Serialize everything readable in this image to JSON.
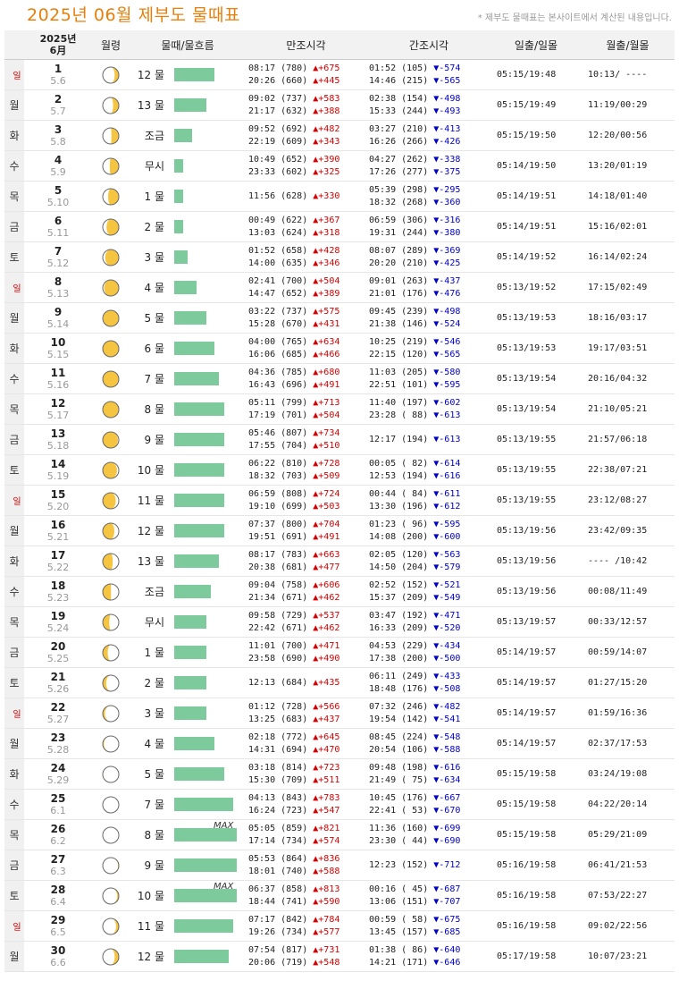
{
  "header": {
    "title": "2025년 06월 제부도 물때표",
    "note": "* 제부도 물때표는 본사이트에서 계산된 내용입니다."
  },
  "columns": {
    "date_year": "2025년",
    "date_month": "6月",
    "moon": "월령",
    "tide": "물때/물흐름",
    "high": "만조시각",
    "low": "간조시각",
    "sun": "일출/일몰",
    "moonrise": "월출/월몰"
  },
  "colors": {
    "sunday": "#d60000",
    "rise": "#d60000",
    "fall": "#0000cc",
    "bar": "#7dcb9d",
    "title": "#e87f0a"
  },
  "rows": [
    {
      "dow": "일",
      "day": "1",
      "lunar": "5.6",
      "tide": "12 물",
      "flow": 0.5,
      "max": "",
      "high": [
        {
          "t": "08:17 (780)",
          "c": "▲+675"
        },
        {
          "t": "20:26 (660)",
          "c": "▲+445"
        }
      ],
      "low": [
        {
          "t": "01:52 (105)",
          "c": "▼-574"
        },
        {
          "t": "14:46 (215)",
          "c": "▼-565"
        }
      ],
      "sun": "05:15/19:48",
      "moon": "10:13/ ----"
    },
    {
      "dow": "월",
      "day": "2",
      "lunar": "5.7",
      "tide": "13 물",
      "flow": 0.4,
      "max": "",
      "high": [
        {
          "t": "09:02 (737)",
          "c": "▲+583"
        },
        {
          "t": "21:17 (632)",
          "c": "▲+388"
        }
      ],
      "low": [
        {
          "t": "02:38 (154)",
          "c": "▼-498"
        },
        {
          "t": "15:33 (244)",
          "c": "▼-493"
        }
      ],
      "sun": "05:15/19:49",
      "moon": "11:19/00:29"
    },
    {
      "dow": "화",
      "day": "3",
      "lunar": "5.8",
      "tide": "조금",
      "flow": 0.22,
      "max": "",
      "high": [
        {
          "t": "09:52 (692)",
          "c": "▲+482"
        },
        {
          "t": "22:19 (609)",
          "c": "▲+343"
        }
      ],
      "low": [
        {
          "t": "03:27 (210)",
          "c": "▼-413"
        },
        {
          "t": "16:26 (266)",
          "c": "▼-426"
        }
      ],
      "sun": "05:15/19:50",
      "moon": "12:20/00:56"
    },
    {
      "dow": "수",
      "day": "4",
      "lunar": "5.9",
      "tide": "무시",
      "flow": 0.11,
      "max": "",
      "high": [
        {
          "t": "10:49 (652)",
          "c": "▲+390"
        },
        {
          "t": "23:33 (602)",
          "c": "▲+325"
        }
      ],
      "low": [
        {
          "t": "04:27 (262)",
          "c": "▼-338"
        },
        {
          "t": "17:26 (277)",
          "c": "▼-375"
        }
      ],
      "sun": "05:14/19:50",
      "moon": "13:20/01:19"
    },
    {
      "dow": "목",
      "day": "5",
      "lunar": "5.10",
      "tide": "1 물",
      "flow": 0.11,
      "max": "",
      "high": [
        {
          "t": "11:56 (628)",
          "c": "▲+330"
        }
      ],
      "low": [
        {
          "t": "05:39 (298)",
          "c": "▼-295"
        },
        {
          "t": "18:32 (268)",
          "c": "▼-360"
        }
      ],
      "sun": "05:14/19:51",
      "moon": "14:18/01:40"
    },
    {
      "dow": "금",
      "day": "6",
      "lunar": "5.11",
      "tide": "2 물",
      "flow": 0.11,
      "max": "",
      "high": [
        {
          "t": "00:49 (622)",
          "c": "▲+367"
        },
        {
          "t": "13:03 (624)",
          "c": "▲+318"
        }
      ],
      "low": [
        {
          "t": "06:59 (306)",
          "c": "▼-316"
        },
        {
          "t": "19:31 (244)",
          "c": "▼-380"
        }
      ],
      "sun": "05:14/19:51",
      "moon": "15:16/02:01"
    },
    {
      "dow": "토",
      "day": "7",
      "lunar": "5.12",
      "tide": "3 물",
      "flow": 0.17,
      "max": "",
      "high": [
        {
          "t": "01:52 (658)",
          "c": "▲+428"
        },
        {
          "t": "14:00 (635)",
          "c": "▲+346"
        }
      ],
      "low": [
        {
          "t": "08:07 (289)",
          "c": "▼-369"
        },
        {
          "t": "20:20 (210)",
          "c": "▼-425"
        }
      ],
      "sun": "05:14/19:52",
      "moon": "16:14/02:24"
    },
    {
      "dow": "일",
      "day": "8",
      "lunar": "5.13",
      "tide": "4 물",
      "flow": 0.28,
      "max": "",
      "high": [
        {
          "t": "02:41 (700)",
          "c": "▲+504"
        },
        {
          "t": "14:47 (652)",
          "c": "▲+389"
        }
      ],
      "low": [
        {
          "t": "09:01 (263)",
          "c": "▼-437"
        },
        {
          "t": "21:01 (176)",
          "c": "▼-476"
        }
      ],
      "sun": "05:13/19:52",
      "moon": "17:15/02:49"
    },
    {
      "dow": "월",
      "day": "9",
      "lunar": "5.14",
      "tide": "5 물",
      "flow": 0.4,
      "max": "",
      "high": [
        {
          "t": "03:22 (737)",
          "c": "▲+575"
        },
        {
          "t": "15:28 (670)",
          "c": "▲+431"
        }
      ],
      "low": [
        {
          "t": "09:45 (239)",
          "c": "▼-498"
        },
        {
          "t": "21:38 (146)",
          "c": "▼-524"
        }
      ],
      "sun": "05:13/19:53",
      "moon": "18:16/03:17"
    },
    {
      "dow": "화",
      "day": "10",
      "lunar": "5.15",
      "tide": "6 물",
      "flow": 0.5,
      "max": "",
      "high": [
        {
          "t": "04:00 (765)",
          "c": "▲+634"
        },
        {
          "t": "16:06 (685)",
          "c": "▲+466"
        }
      ],
      "low": [
        {
          "t": "10:25 (219)",
          "c": "▼-546"
        },
        {
          "t": "22:15 (120)",
          "c": "▼-565"
        }
      ],
      "sun": "05:13/19:53",
      "moon": "19:17/03:51"
    },
    {
      "dow": "수",
      "day": "11",
      "lunar": "5.16",
      "tide": "7 물",
      "flow": 0.56,
      "max": "",
      "high": [
        {
          "t": "04:36 (785)",
          "c": "▲+680"
        },
        {
          "t": "16:43 (696)",
          "c": "▲+491"
        }
      ],
      "low": [
        {
          "t": "11:03 (205)",
          "c": "▼-580"
        },
        {
          "t": "22:51 (101)",
          "c": "▼-595"
        }
      ],
      "sun": "05:13/19:54",
      "moon": "20:16/04:32"
    },
    {
      "dow": "목",
      "day": "12",
      "lunar": "5.17",
      "tide": "8 물",
      "flow": 0.62,
      "max": "",
      "high": [
        {
          "t": "05:11 (799)",
          "c": "▲+713"
        },
        {
          "t": "17:19 (701)",
          "c": "▲+504"
        }
      ],
      "low": [
        {
          "t": "11:40 (197)",
          "c": "▼-602"
        },
        {
          "t": "23:28 ( 88)",
          "c": "▼-613"
        }
      ],
      "sun": "05:13/19:54",
      "moon": "21:10/05:21"
    },
    {
      "dow": "금",
      "day": "13",
      "lunar": "5.18",
      "tide": "9 물",
      "flow": 0.62,
      "max": "",
      "high": [
        {
          "t": "05:46 (807)",
          "c": "▲+734"
        },
        {
          "t": "17:55 (704)",
          "c": "▲+510"
        }
      ],
      "low": [
        {
          "t": "12:17 (194)",
          "c": "▼-613"
        }
      ],
      "sun": "05:13/19:55",
      "moon": "21:57/06:18"
    },
    {
      "dow": "토",
      "day": "14",
      "lunar": "5.19",
      "tide": "10 물",
      "flow": 0.62,
      "max": "",
      "high": [
        {
          "t": "06:22 (810)",
          "c": "▲+728"
        },
        {
          "t": "18:32 (703)",
          "c": "▲+509"
        }
      ],
      "low": [
        {
          "t": "00:05 ( 82)",
          "c": "▼-614"
        },
        {
          "t": "12:53 (194)",
          "c": "▼-616"
        }
      ],
      "sun": "05:13/19:55",
      "moon": "22:38/07:21"
    },
    {
      "dow": "일",
      "day": "15",
      "lunar": "5.20",
      "tide": "11 물",
      "flow": 0.62,
      "max": "",
      "high": [
        {
          "t": "06:59 (808)",
          "c": "▲+724"
        },
        {
          "t": "19:10 (699)",
          "c": "▲+503"
        }
      ],
      "low": [
        {
          "t": "00:44 ( 84)",
          "c": "▼-611"
        },
        {
          "t": "13:30 (196)",
          "c": "▼-612"
        }
      ],
      "sun": "05:13/19:55",
      "moon": "23:12/08:27"
    },
    {
      "dow": "월",
      "day": "16",
      "lunar": "5.21",
      "tide": "12 물",
      "flow": 0.62,
      "max": "",
      "high": [
        {
          "t": "07:37 (800)",
          "c": "▲+704"
        },
        {
          "t": "19:51 (691)",
          "c": "▲+491"
        }
      ],
      "low": [
        {
          "t": "01:23 ( 96)",
          "c": "▼-595"
        },
        {
          "t": "14:08 (200)",
          "c": "▼-600"
        }
      ],
      "sun": "05:13/19:56",
      "moon": "23:42/09:35"
    },
    {
      "dow": "화",
      "day": "17",
      "lunar": "5.22",
      "tide": "13 물",
      "flow": 0.56,
      "max": "",
      "high": [
        {
          "t": "08:17 (783)",
          "c": "▲+663"
        },
        {
          "t": "20:38 (681)",
          "c": "▲+477"
        }
      ],
      "low": [
        {
          "t": "02:05 (120)",
          "c": "▼-563"
        },
        {
          "t": "14:50 (204)",
          "c": "▼-579"
        }
      ],
      "sun": "05:13/19:56",
      "moon": "---- /10:42"
    },
    {
      "dow": "수",
      "day": "18",
      "lunar": "5.23",
      "tide": "조금",
      "flow": 0.45,
      "max": "",
      "high": [
        {
          "t": "09:04 (758)",
          "c": "▲+606"
        },
        {
          "t": "21:34 (671)",
          "c": "▲+462"
        }
      ],
      "low": [
        {
          "t": "02:52 (152)",
          "c": "▼-521"
        },
        {
          "t": "15:37 (209)",
          "c": "▼-549"
        }
      ],
      "sun": "05:13/19:56",
      "moon": "00:08/11:49"
    },
    {
      "dow": "목",
      "day": "19",
      "lunar": "5.24",
      "tide": "무시",
      "flow": 0.4,
      "max": "",
      "high": [
        {
          "t": "09:58 (729)",
          "c": "▲+537"
        },
        {
          "t": "22:42 (671)",
          "c": "▲+462"
        }
      ],
      "low": [
        {
          "t": "03:47 (192)",
          "c": "▼-471"
        },
        {
          "t": "16:33 (209)",
          "c": "▼-520"
        }
      ],
      "sun": "05:13/19:57",
      "moon": "00:33/12:57"
    },
    {
      "dow": "금",
      "day": "20",
      "lunar": "5.25",
      "tide": "1 물",
      "flow": 0.4,
      "max": "",
      "high": [
        {
          "t": "11:01 (700)",
          "c": "▲+471"
        },
        {
          "t": "23:58 (690)",
          "c": "▲+490"
        }
      ],
      "low": [
        {
          "t": "04:53 (229)",
          "c": "▼-434"
        },
        {
          "t": "17:38 (200)",
          "c": "▼-500"
        }
      ],
      "sun": "05:14/19:57",
      "moon": "00:59/14:07"
    },
    {
      "dow": "토",
      "day": "21",
      "lunar": "5.26",
      "tide": "2 물",
      "flow": 0.4,
      "max": "",
      "high": [
        {
          "t": "12:13 (684)",
          "c": "▲+435"
        }
      ],
      "low": [
        {
          "t": "06:11 (249)",
          "c": "▼-433"
        },
        {
          "t": "18:48 (176)",
          "c": "▼-508"
        }
      ],
      "sun": "05:14/19:57",
      "moon": "01:27/15:20"
    },
    {
      "dow": "일",
      "day": "22",
      "lunar": "5.27",
      "tide": "3 물",
      "flow": 0.4,
      "max": "",
      "high": [
        {
          "t": "01:12 (728)",
          "c": "▲+566"
        },
        {
          "t": "13:25 (683)",
          "c": "▲+437"
        }
      ],
      "low": [
        {
          "t": "07:32 (246)",
          "c": "▼-482"
        },
        {
          "t": "19:54 (142)",
          "c": "▼-541"
        }
      ],
      "sun": "05:14/19:57",
      "moon": "01:59/16:36"
    },
    {
      "dow": "월",
      "day": "23",
      "lunar": "5.28",
      "tide": "4 물",
      "flow": 0.5,
      "max": "",
      "high": [
        {
          "t": "02:18 (772)",
          "c": "▲+645"
        },
        {
          "t": "14:31 (694)",
          "c": "▲+470"
        }
      ],
      "low": [
        {
          "t": "08:45 (224)",
          "c": "▼-548"
        },
        {
          "t": "20:54 (106)",
          "c": "▼-588"
        }
      ],
      "sun": "05:14/19:57",
      "moon": "02:37/17:53"
    },
    {
      "dow": "화",
      "day": "24",
      "lunar": "5.29",
      "tide": "5 물",
      "flow": 0.62,
      "max": "",
      "high": [
        {
          "t": "03:18 (814)",
          "c": "▲+723"
        },
        {
          "t": "15:30 (709)",
          "c": "▲+511"
        }
      ],
      "low": [
        {
          "t": "09:48 (198)",
          "c": "▼-616"
        },
        {
          "t": "21:49 ( 75)",
          "c": "▼-634"
        }
      ],
      "sun": "05:15/19:58",
      "moon": "03:24/19:08"
    },
    {
      "dow": "수",
      "day": "25",
      "lunar": "6.1",
      "tide": "7 물",
      "flow": 0.73,
      "max": "",
      "high": [
        {
          "t": "04:13 (843)",
          "c": "▲+783"
        },
        {
          "t": "16:24 (723)",
          "c": "▲+547"
        }
      ],
      "low": [
        {
          "t": "10:45 (176)",
          "c": "▼-667"
        },
        {
          "t": "22:41 ( 53)",
          "c": "▼-670"
        }
      ],
      "sun": "05:15/19:58",
      "moon": "04:22/20:14"
    },
    {
      "dow": "목",
      "day": "26",
      "lunar": "6.2",
      "tide": "8 물",
      "flow": 0.78,
      "max": "MAX",
      "high": [
        {
          "t": "05:05 (859)",
          "c": "▲+821"
        },
        {
          "t": "17:14 (734)",
          "c": "▲+574"
        }
      ],
      "low": [
        {
          "t": "11:36 (160)",
          "c": "▼-699"
        },
        {
          "t": "23:30 ( 44)",
          "c": "▼-690"
        }
      ],
      "sun": "05:15/19:58",
      "moon": "05:29/21:09"
    },
    {
      "dow": "금",
      "day": "27",
      "lunar": "6.3",
      "tide": "9 물",
      "flow": 0.78,
      "max": "",
      "high": [
        {
          "t": "05:53 (864)",
          "c": "▲+836"
        },
        {
          "t": "18:01 (740)",
          "c": "▲+588"
        }
      ],
      "low": [
        {
          "t": "12:23 (152)",
          "c": "▼-712"
        }
      ],
      "sun": "05:16/19:58",
      "moon": "06:41/21:53"
    },
    {
      "dow": "토",
      "day": "28",
      "lunar": "6.4",
      "tide": "10 물",
      "flow": 0.78,
      "max": "MAX",
      "high": [
        {
          "t": "06:37 (858)",
          "c": "▲+813"
        },
        {
          "t": "18:44 (741)",
          "c": "▲+590"
        }
      ],
      "low": [
        {
          "t": "00:16 ( 45)",
          "c": "▼-687"
        },
        {
          "t": "13:06 (151)",
          "c": "▼-707"
        }
      ],
      "sun": "05:16/19:58",
      "moon": "07:53/22:27"
    },
    {
      "dow": "일",
      "day": "29",
      "lunar": "6.5",
      "tide": "11 물",
      "flow": 0.73,
      "max": "",
      "high": [
        {
          "t": "07:17 (842)",
          "c": "▲+784"
        },
        {
          "t": "19:26 (734)",
          "c": "▲+577"
        }
      ],
      "low": [
        {
          "t": "00:59 ( 58)",
          "c": "▼-675"
        },
        {
          "t": "13:45 (157)",
          "c": "▼-685"
        }
      ],
      "sun": "05:16/19:58",
      "moon": "09:02/22:56"
    },
    {
      "dow": "월",
      "day": "30",
      "lunar": "6.6",
      "tide": "12 물",
      "flow": 0.68,
      "max": "",
      "high": [
        {
          "t": "07:54 (817)",
          "c": "▲+731"
        },
        {
          "t": "20:06 (719)",
          "c": "▲+548"
        }
      ],
      "low": [
        {
          "t": "01:38 ( 86)",
          "c": "▼-640"
        },
        {
          "t": "14:21 (171)",
          "c": "▼-646"
        }
      ],
      "sun": "05:17/19:58",
      "moon": "10:07/23:21"
    }
  ]
}
